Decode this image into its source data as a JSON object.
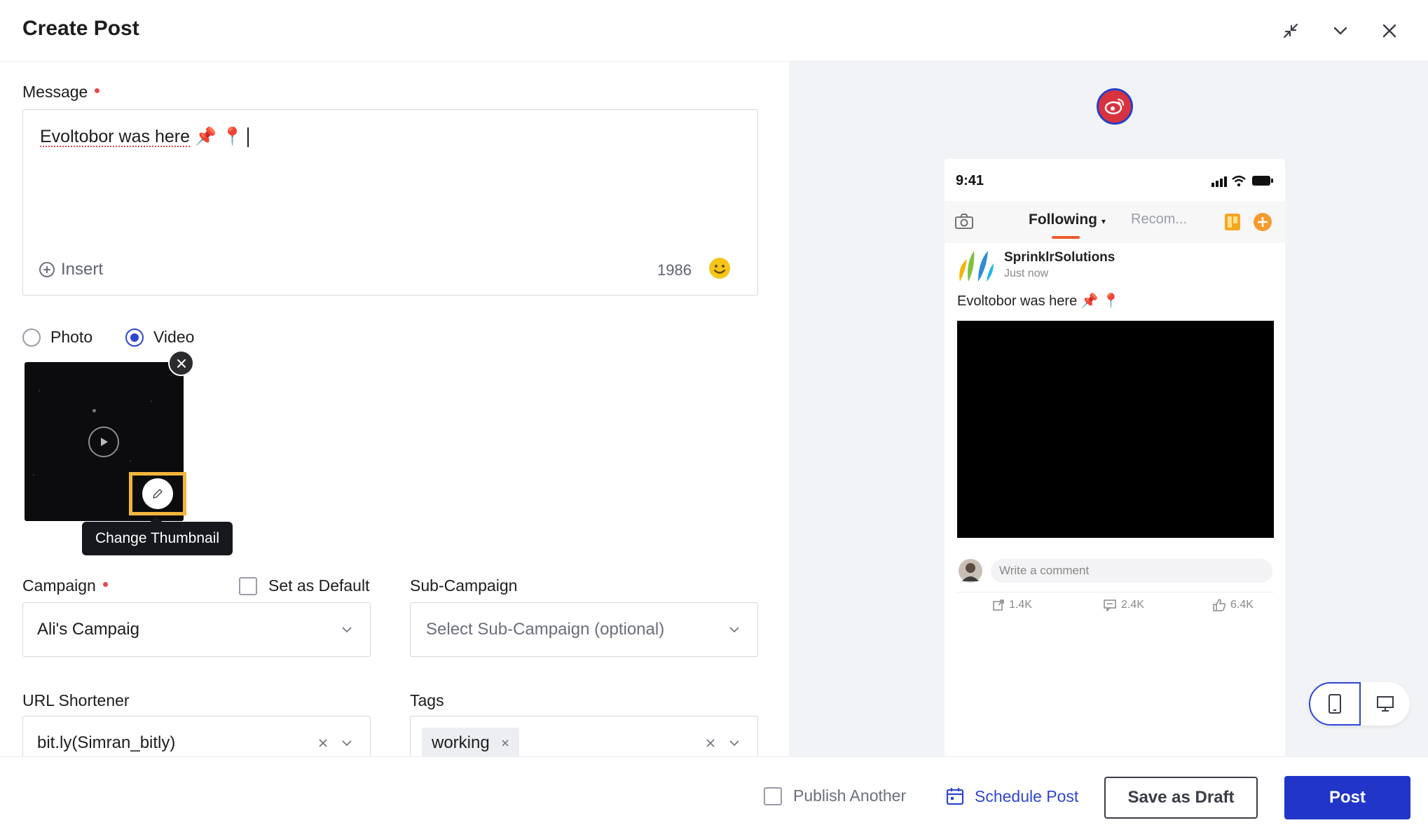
{
  "header": {
    "title": "Create Post",
    "icons": [
      "collapse-icon",
      "chevron-down-icon",
      "close-icon"
    ]
  },
  "message": {
    "label": "Message",
    "text": "Evoltobor was here",
    "emojis": "📌 📍",
    "insert_label": "Insert",
    "char_count": "1986"
  },
  "media": {
    "options": [
      {
        "label": "Photo",
        "selected": false
      },
      {
        "label": "Video",
        "selected": true
      }
    ],
    "tooltip": "Change Thumbnail"
  },
  "campaign": {
    "label": "Campaign",
    "set_default_label": "Set as Default",
    "value": "Ali's Campaig"
  },
  "sub_campaign": {
    "label": "Sub-Campaign",
    "placeholder": "Select Sub-Campaign (optional)"
  },
  "url_shortener": {
    "label": "URL Shortener",
    "value": "bit.ly(Simran_bitly)"
  },
  "tags": {
    "label": "Tags",
    "chips": [
      "working"
    ]
  },
  "preview": {
    "time": "9:41",
    "tab_active": "Following",
    "tab_other": "Recom...",
    "account_name": "SprinklrSolutions",
    "post_time": "Just now",
    "post_text": "Evoltobor was here",
    "post_emojis": "📌 📍",
    "comment_placeholder": "Write a comment",
    "stats": {
      "shares": "1.4K",
      "comments": "2.4K",
      "likes": "6.4K"
    }
  },
  "footer": {
    "publish_another": "Publish Another",
    "schedule": "Schedule Post",
    "save_draft": "Save as Draft",
    "post": "Post"
  },
  "colors": {
    "primary": "#2135c9",
    "required_dot": "#e5484d",
    "highlight": "#f2b43d",
    "weibo_red": "#d8323f",
    "emoji_yellow": "#f5c518"
  }
}
